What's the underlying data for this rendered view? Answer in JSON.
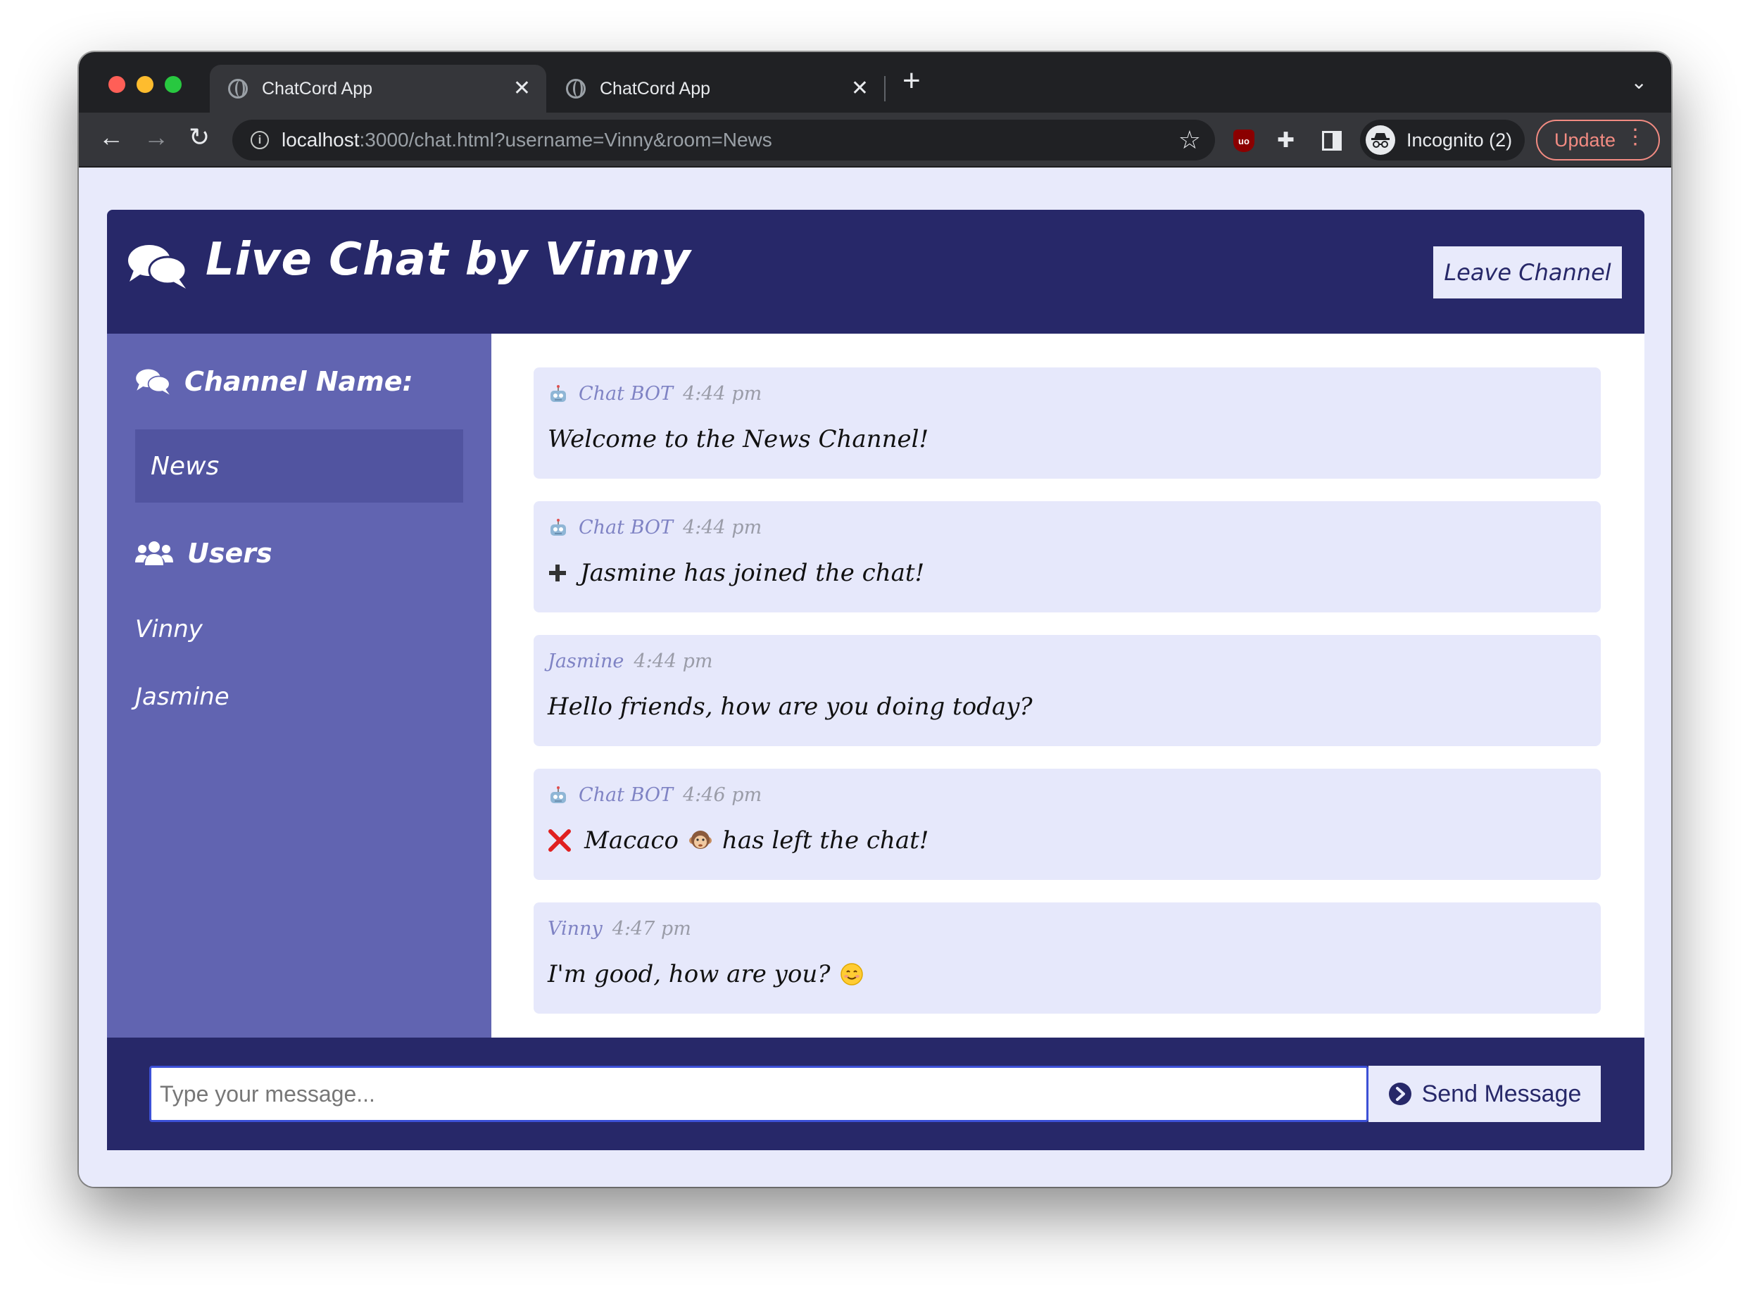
{
  "browser": {
    "tabs": [
      {
        "title": "ChatCord App",
        "close": "✕"
      },
      {
        "title": "ChatCord App",
        "close": "✕"
      }
    ],
    "new_tab": "+",
    "tab_search": "⌄",
    "nav": {
      "back": "←",
      "forward": "→",
      "reload": "↻"
    },
    "url_host": "localhost",
    "url_rest": ":3000/chat.html?username=Vinny&room=News",
    "bookmark": "☆",
    "extensions": {
      "ublock": "uo",
      "puzzle": "✚"
    },
    "profile_label": "Incognito (2)",
    "update_label": "Update",
    "menu_dots": "⋮"
  },
  "header": {
    "title": "Live Chat by Vinny",
    "leave_label": "Leave Channel"
  },
  "sidebar": {
    "channel_heading": "Channel Name:",
    "room_name": "News",
    "users_heading": "Users",
    "users": [
      "Vinny",
      "Jasmine"
    ]
  },
  "messages": [
    {
      "sender": "Chat BOT",
      "time": "4:44 pm",
      "bot": true,
      "prefix": "",
      "text": "Welcome to the News Channel!"
    },
    {
      "sender": "Chat BOT",
      "time": "4:44 pm",
      "bot": true,
      "prefix": "plus-icon",
      "text": "Jasmine has joined the chat!"
    },
    {
      "sender": "Jasmine",
      "time": "4:44 pm",
      "bot": false,
      "prefix": "",
      "text": "Hello friends, how are you doing today?"
    },
    {
      "sender": "Chat BOT",
      "time": "4:46 pm",
      "bot": true,
      "prefix": "cross-icon",
      "text_before": "Macaco",
      "emoji": "monkey-icon",
      "text_after": "has left the chat!"
    },
    {
      "sender": "Vinny",
      "time": "4:47 pm",
      "bot": false,
      "prefix": "",
      "text": "I'm good, how are you?",
      "emoji": "smile-icon"
    }
  ],
  "form": {
    "placeholder": "Type your message...",
    "send_label": "Send Message"
  },
  "colors": {
    "header_bg": "#272869",
    "sidebar_bg": "#6164b1",
    "room_box_bg": "#5154a0",
    "message_bg": "#e6e8fb",
    "page_bg": "#e8eafb"
  }
}
